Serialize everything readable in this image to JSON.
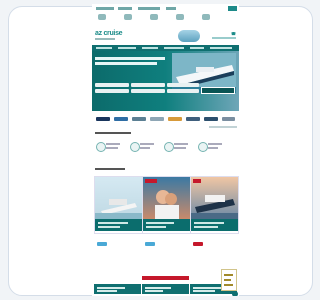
{
  "brand": {
    "logo_text": "az cruise"
  },
  "colors": {
    "primary": "#0f6f70",
    "accent": "#c5182b"
  },
  "icons": [
    "phone-icon",
    "ship-icon",
    "shield-icon",
    "gift-icon",
    "globe-icon",
    "chevron-up-icon"
  ]
}
